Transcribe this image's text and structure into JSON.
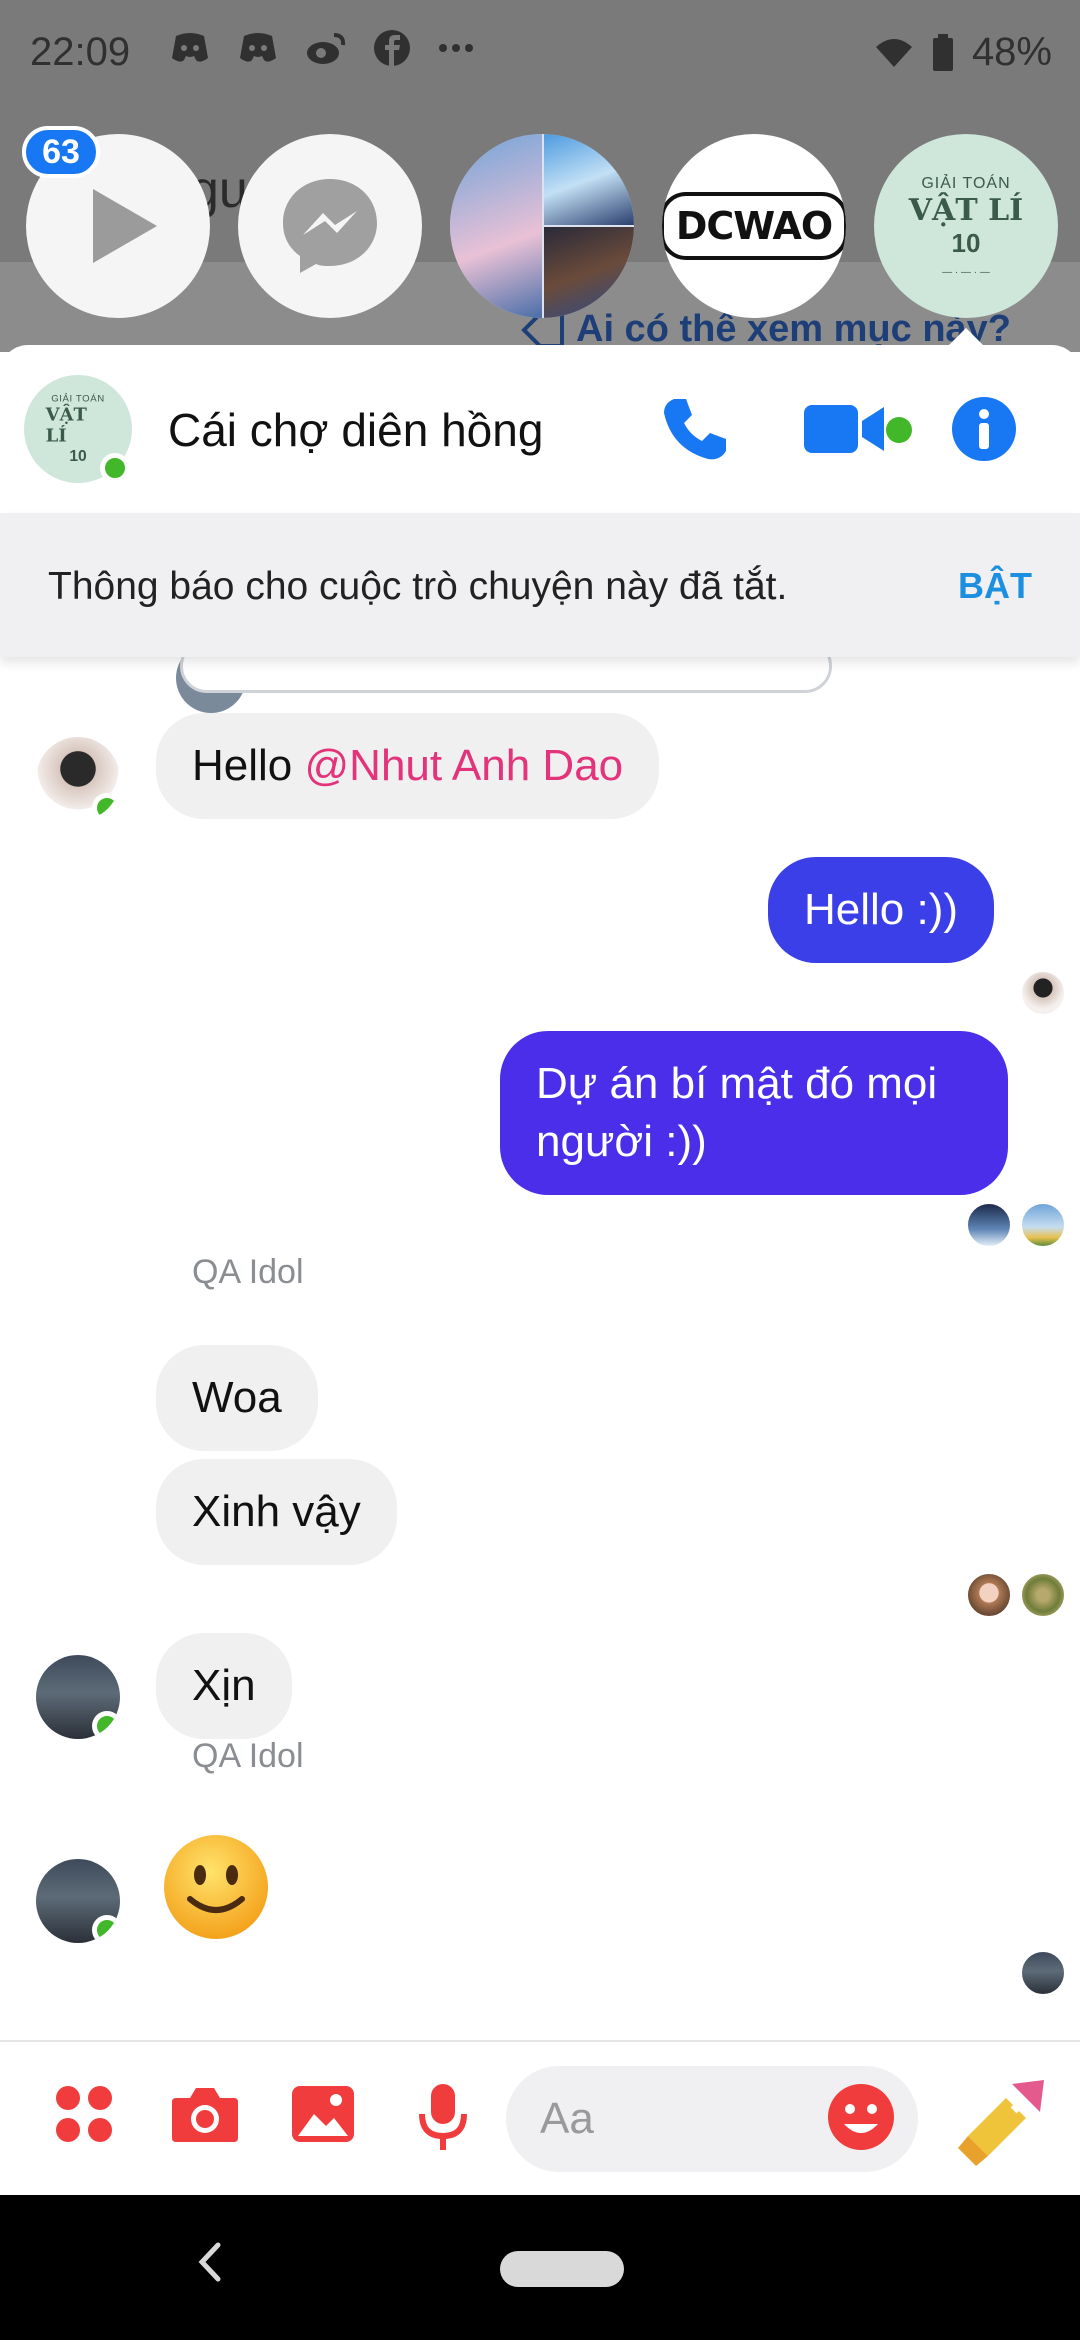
{
  "status_bar": {
    "time": "22:09",
    "battery_percent": "48%"
  },
  "chat_heads": {
    "badge_count": "63",
    "dcwao_logo": "DCWAO",
    "book_cover": {
      "line1": "GIẢI TOÁN",
      "line2": "VẬT LÍ",
      "line3": "10"
    }
  },
  "background_page": {
    "partial_text": "gu i",
    "privacy_link": "Ai có thể xem mục này?"
  },
  "conversation": {
    "title": "Cái chợ diên hồng",
    "notice_text": "Thông báo cho cuộc trò chuyện này đã tắt.",
    "notice_action": "BẬT"
  },
  "messages": [
    {
      "text_prefix": "Hello ",
      "mention": "@Nhut Anh Dao"
    },
    {
      "text": "Hello :))"
    },
    {
      "text_line1": "Dự án bí mật đó mọi",
      "text_line2": "người :))"
    },
    {
      "sender": "QA Idol",
      "text": "Woa"
    },
    {
      "text": "Xinh vậy"
    },
    {
      "text": "Xịn"
    },
    {
      "sender": "QA Idol",
      "emoji": "slightly-smiling-face"
    }
  ],
  "composer": {
    "placeholder": "Aa"
  },
  "colors": {
    "messenger_blue": "#3b3fe8",
    "messenger_purple": "#4a2eea",
    "mention_pink": "#e2337b",
    "composer_red": "#f03c3c",
    "online_green": "#42b72a",
    "notice_action_blue": "#1d8fe0"
  }
}
